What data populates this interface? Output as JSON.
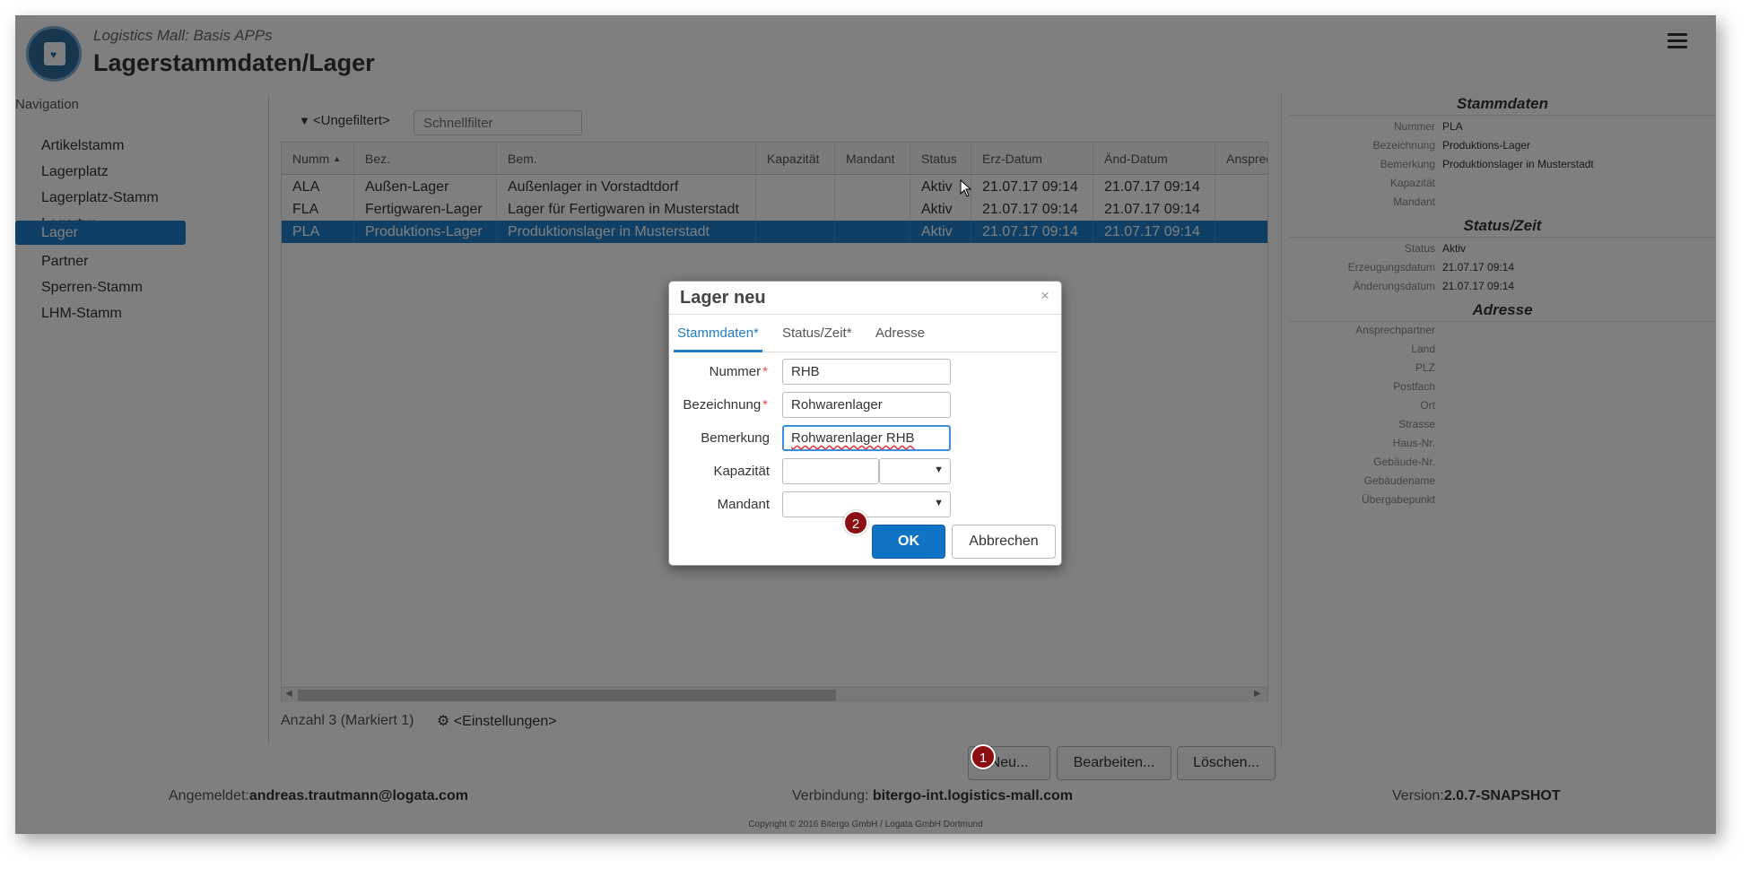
{
  "header": {
    "subtitle": "Logistics Mall: Basis APPs",
    "title": "Lagerstammdaten/Lager",
    "menu_icon": "hamburger-menu-icon"
  },
  "navigation": {
    "label": "Navigation",
    "items": [
      {
        "label": "Artikelstamm",
        "active": false
      },
      {
        "label": "Lagerplatz",
        "active": false
      },
      {
        "label": "Lagerplatz-Stamm",
        "active": false
      },
      {
        "label": "Lagertyp",
        "active": false
      },
      {
        "label": "Lager",
        "active": true
      },
      {
        "label": "Partner",
        "active": false
      },
      {
        "label": "Sperren-Stamm",
        "active": false
      },
      {
        "label": "LHM-Stamm",
        "active": false
      }
    ]
  },
  "filter": {
    "label": "<Ungefiltert>",
    "quickfilter_placeholder": "Schnellfilter"
  },
  "table": {
    "columns": [
      "Numm",
      "Bez.",
      "Bem.",
      "Kapazität",
      "Mandant",
      "Status",
      "Erz-Datum",
      "Änd-Datum",
      "Ansprec"
    ],
    "rows": [
      {
        "cells": [
          "ALA",
          "Außen-Lager",
          "Außenlager in Vorstadtdorf",
          "",
          "",
          "Aktiv",
          "21.07.17 09:14",
          "21.07.17 09:14",
          ""
        ],
        "selected": false
      },
      {
        "cells": [
          "FLA",
          "Fertigwaren-Lager",
          "Lager für Fertigwaren in Musterstadt",
          "",
          "",
          "Aktiv",
          "21.07.17 09:14",
          "21.07.17 09:14",
          ""
        ],
        "selected": false
      },
      {
        "cells": [
          "PLA",
          "Produktions-Lager",
          "Produktionslager in Musterstadt",
          "",
          "",
          "Aktiv",
          "21.07.17 09:14",
          "21.07.17 09:14",
          ""
        ],
        "selected": true
      }
    ],
    "count_text": "Anzahl 3 (Markiert 1)",
    "settings_label": "<Einstellungen>"
  },
  "actions": {
    "new": "Neu...",
    "edit": "Bearbeiten...",
    "delete": "Löschen..."
  },
  "detail": {
    "sections": [
      {
        "title": "Stammdaten",
        "fields": [
          {
            "label": "Nummer",
            "value": "PLA"
          },
          {
            "label": "Bezeichnung",
            "value": "Produktions-Lager"
          },
          {
            "label": "Bemerkung",
            "value": "Produktionslager in Musterstadt"
          },
          {
            "label": "Kapazität",
            "value": ""
          },
          {
            "label": "Mandant",
            "value": ""
          }
        ]
      },
      {
        "title": "Status/Zeit",
        "fields": [
          {
            "label": "Status",
            "value": "Aktiv"
          },
          {
            "label": "Erzeugungsdatum",
            "value": "21.07.17 09:14"
          },
          {
            "label": "Änderungsdatum",
            "value": "21.07.17 09:14"
          }
        ]
      },
      {
        "title": "Adresse",
        "fields": [
          {
            "label": "Ansprechpartner",
            "value": ""
          },
          {
            "label": "Land",
            "value": ""
          },
          {
            "label": "PLZ",
            "value": ""
          },
          {
            "label": "Postfach",
            "value": ""
          },
          {
            "label": "Ort",
            "value": ""
          },
          {
            "label": "Strasse",
            "value": ""
          },
          {
            "label": "Haus-Nr.",
            "value": ""
          },
          {
            "label": "Gebäude-Nr.",
            "value": ""
          },
          {
            "label": "Gebäudename",
            "value": ""
          },
          {
            "label": "Übergabepunkt",
            "value": ""
          }
        ]
      }
    ]
  },
  "footer": {
    "logged_in_label": "Angemeldet:",
    "user": "andreas.trautmann@logata.com",
    "connection_label": "Verbindung:",
    "connection": "bitergo-int.logistics-mall.com",
    "version_label": "Version:",
    "version": "2.0.7-SNAPSHOT",
    "copyright": "Copyright © 2016 Bitergo GmbH / Logata GmbH Dortmund"
  },
  "dialog": {
    "title": "Lager neu",
    "close": "×",
    "tabs": [
      {
        "label": "Stammdaten*",
        "active": true
      },
      {
        "label": "Status/Zeit*",
        "active": false
      },
      {
        "label": "Adresse",
        "active": false
      }
    ],
    "fields": {
      "nummer": {
        "label": "Nummer",
        "value": "RHB",
        "required": true
      },
      "bezeichnung": {
        "label": "Bezeichnung",
        "value": "Rohwarenlager",
        "required": true
      },
      "bemerkung": {
        "label": "Bemerkung",
        "value": "Rohwarenlager RHB",
        "required": false
      },
      "kapazitaet": {
        "label": "Kapazität",
        "value": ""
      },
      "mandant": {
        "label": "Mandant",
        "value": ""
      }
    },
    "required_mark": "*",
    "ok": "OK",
    "cancel": "Abbrechen"
  },
  "badges": {
    "one": "1",
    "two": "2"
  },
  "colors": {
    "accent": "#1f7ec8",
    "badge": "#8b0f12",
    "primary_button": "#1173c6"
  }
}
